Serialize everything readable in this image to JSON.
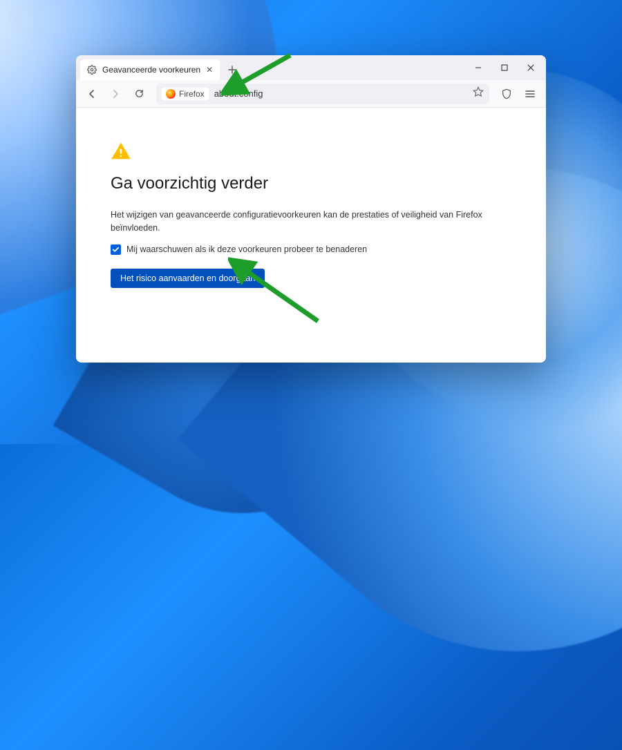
{
  "tab": {
    "title": "Geavanceerde voorkeuren"
  },
  "urlbar": {
    "identity_label": "Firefox",
    "url": "about:config"
  },
  "warning": {
    "title": "Ga voorzichtig verder",
    "description": "Het wijzigen van geavanceerde configuratievoorkeuren kan de prestaties of veiligheid van Firefox beïnvloeden.",
    "checkbox_label": "Mij waarschuwen als ik deze voorkeuren probeer te benaderen",
    "checkbox_checked": true,
    "button_label": "Het risico aanvaarden en doorgaan"
  }
}
